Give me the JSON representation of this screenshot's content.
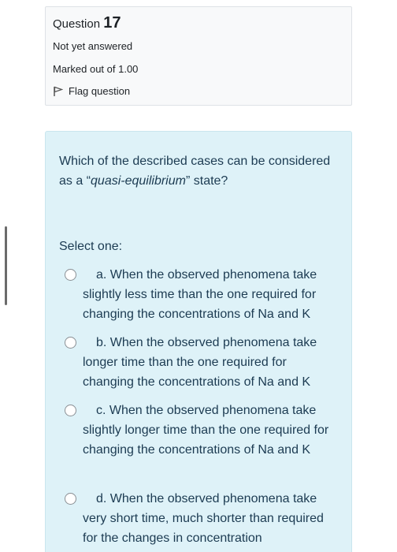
{
  "question": {
    "label": "Question",
    "number": "17",
    "state": "Not yet answered",
    "grade": "Marked out of 1.00",
    "flag_label": "Flag question"
  },
  "content": {
    "text_before": "Which of the described cases can be considered as a “",
    "text_em": "quasi-equilibrium",
    "text_after": "” state?",
    "prompt": "Select one:",
    "answers": [
      {
        "label": "a. When the observed phenomena take slightly less time than the one required for changing the concentrations of Na and K"
      },
      {
        "label": "b. When the observed phenomena take longer time than the one required for changing the concentrations of Na and K"
      },
      {
        "label": "c. When the observed phenomena take slightly longer time than the one required for changing the concentrations of Na and K"
      },
      {
        "label": "d. When the observed phenomena take very short time, much shorter than required for the changes in concentration"
      }
    ]
  },
  "icons": {
    "flag": "flag-icon",
    "radio": "radio-unchecked-icon"
  },
  "colors": {
    "info_bg": "#f8f9fa",
    "content_bg": "#def2f8",
    "text": "#1c3b52"
  }
}
